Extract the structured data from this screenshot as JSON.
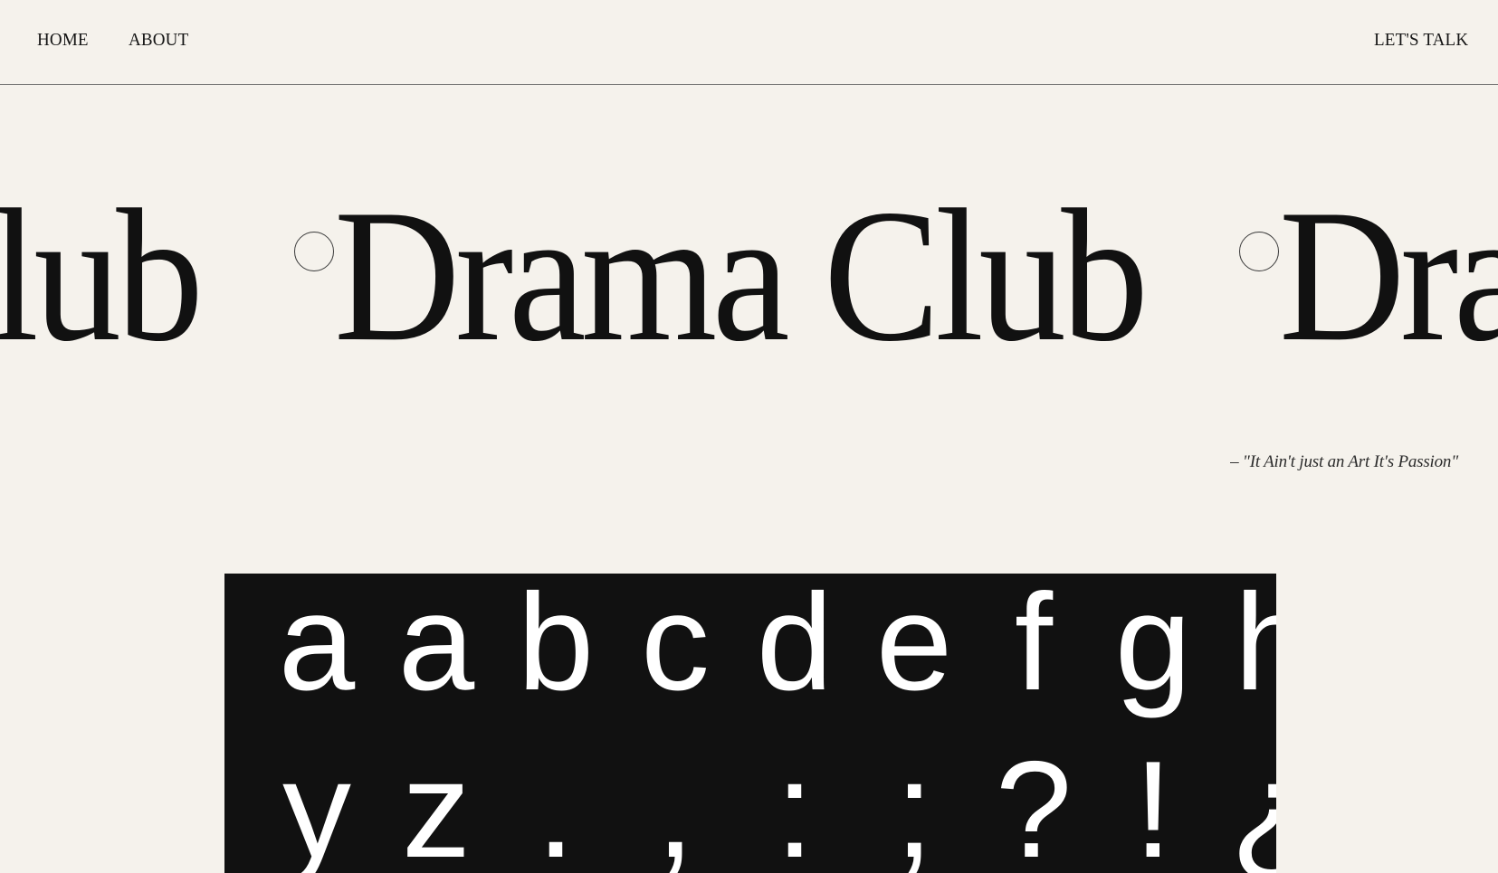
{
  "nav": {
    "home_label": "HOME",
    "about_label": "ABOUT",
    "talk_label": "LET'S TALK"
  },
  "hero": {
    "title": "Drama Club"
  },
  "quote": "– \"It Ain't just an Art It's Passion\"",
  "specimen": {
    "row1": [
      "a",
      "a",
      "b",
      "c",
      "d",
      "e",
      "f",
      "g",
      "h"
    ],
    "row2": [
      "y",
      "z",
      ".",
      ",",
      ":",
      ";",
      "?",
      "!",
      "¿",
      "¿",
      "¡",
      "¡"
    ]
  },
  "colors": {
    "background": "#f5f2ec",
    "text": "#141414",
    "specimen_bg": "#111111",
    "specimen_text": "#ffffff"
  }
}
